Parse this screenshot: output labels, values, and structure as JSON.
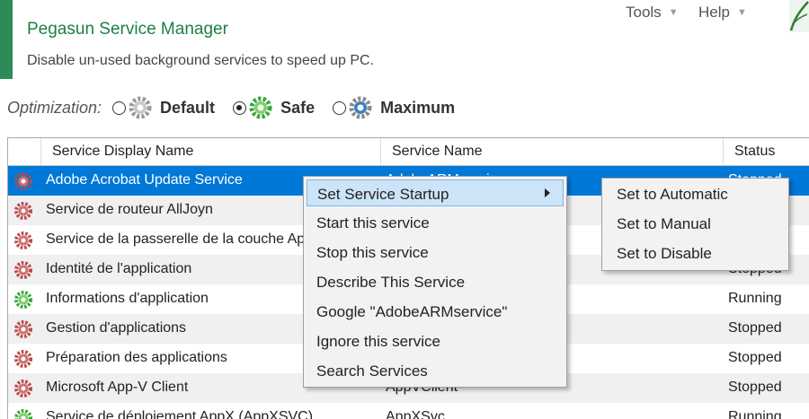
{
  "header": {
    "title": "Pegasun Service Manager",
    "subtitle": "Disable un-used background services to speed up PC.",
    "menu": [
      {
        "label": "Tools"
      },
      {
        "label": "Help"
      }
    ]
  },
  "optimization": {
    "label": "Optimization:",
    "options": [
      {
        "label": "Default",
        "checked": false,
        "gear_color": "#9a9a9a"
      },
      {
        "label": "Safe",
        "checked": true,
        "gear_color": "#3aa63a"
      },
      {
        "label": "Maximum",
        "checked": false,
        "gear_color": "#3a7fc0"
      }
    ]
  },
  "table": {
    "columns": [
      "Service Display Name",
      "Service Name",
      "Status"
    ],
    "rows": [
      {
        "name": "Adobe Acrobat Update Service",
        "service": "AdobeARMservice",
        "status": "Stopped",
        "icon": "red-gear-icon",
        "selected": true
      },
      {
        "name": "Service de routeur AllJoyn",
        "service": "",
        "status": "",
        "icon": "red-gear-icon"
      },
      {
        "name": "Service de la passerelle de la couche Ap",
        "service": "",
        "status": "",
        "icon": "red-gear-icon"
      },
      {
        "name": "Identité de l'application",
        "service": "",
        "status": "Stopped",
        "icon": "red-gear-icon"
      },
      {
        "name": "Informations d'application",
        "service": "",
        "status": "Running",
        "icon": "green-gear-icon"
      },
      {
        "name": "Gestion d'applications",
        "service": "",
        "status": "Stopped",
        "icon": "red-gear-icon"
      },
      {
        "name": "Préparation des applications",
        "service": "",
        "status": "Stopped",
        "icon": "red-gear-icon"
      },
      {
        "name": "Microsoft App-V Client",
        "service": "AppVClient",
        "status": "Stopped",
        "icon": "red-gear-icon"
      },
      {
        "name": "Service de déploiement AppX (AppXSVC)",
        "service": "AppXSvc",
        "status": "Running",
        "icon": "green-gear-icon"
      }
    ]
  },
  "context_menu": {
    "items": [
      {
        "label": "Set Service Startup",
        "has_submenu": true,
        "highlighted": true
      },
      {
        "label": "Start this service"
      },
      {
        "label": "Stop this service"
      },
      {
        "label": "Describe This Service"
      },
      {
        "label": "Google \"AdobeARMservice\""
      },
      {
        "label": "Ignore this service"
      },
      {
        "label": "Search Services"
      }
    ],
    "submenu": [
      {
        "label": "Set to Automatic"
      },
      {
        "label": "Set to Manual"
      },
      {
        "label": "Set to Disable"
      }
    ]
  },
  "colors": {
    "accent": "#2e8b57",
    "selection": "#0078d7",
    "menu_highlight": "#cce4f7"
  }
}
